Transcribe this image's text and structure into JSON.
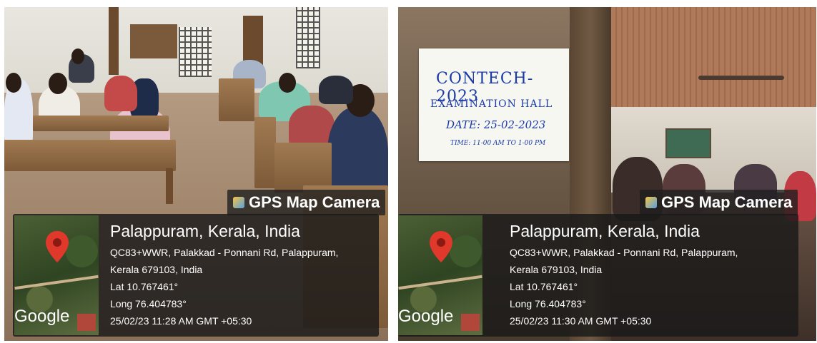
{
  "left": {
    "badge": "GPS Map Camera",
    "title": "Palappuram, Kerala, India",
    "address_1": "QC83+WWR, Palakkad - Ponnani Rd, Palappuram,",
    "address_2": "Kerala 679103, India",
    "lat": "Lat 10.767461°",
    "long": "Long 76.404783°",
    "timestamp": "25/02/23 11:28 AM GMT +05:30",
    "map_label": "Google"
  },
  "right": {
    "badge": "GPS Map Camera",
    "title": "Palappuram, Kerala, India",
    "address_1": "QC83+WWR, Palakkad - Ponnani Rd, Palappuram,",
    "address_2": "Kerala 679103, India",
    "lat": "Lat 10.767461°",
    "long": "Long 76.404783°",
    "timestamp": "25/02/23 11:30 AM GMT +05:30",
    "map_label": "Google",
    "notice": {
      "line1": "CONTECH-2023",
      "line2": "EXAMINATION HALL",
      "line3": "DATE: 25-02-2023",
      "line4": "TIME: 11-00 AM TO 1-00 PM"
    }
  },
  "colors": {
    "overlay": "#191919",
    "pin": "#e0392b",
    "notice_ink": "#1a3aa8"
  }
}
